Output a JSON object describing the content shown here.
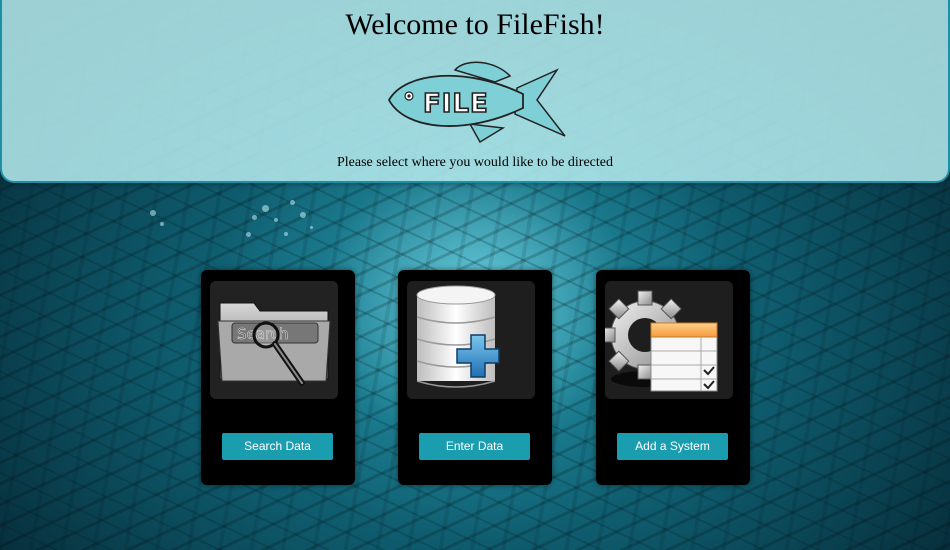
{
  "header": {
    "title": "Welcome to FileFish!",
    "logo_text": "FILE",
    "subtitle": "Please select where you would like to be directed"
  },
  "cards": [
    {
      "icon": "search-folder-icon",
      "icon_text": "Search",
      "button_label": "Search Data"
    },
    {
      "icon": "database-add-icon",
      "button_label": "Enter Data"
    },
    {
      "icon": "system-config-icon",
      "button_label": "Add a System"
    }
  ],
  "colors": {
    "header_bg": "#b2e8ec",
    "header_border": "#1d8fa6",
    "button_bg": "#1b9db0",
    "card_bg": "#000000"
  }
}
